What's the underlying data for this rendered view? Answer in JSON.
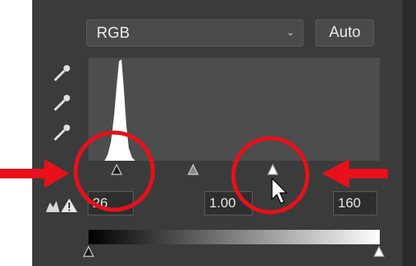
{
  "levels": {
    "channel": "RGB",
    "auto_label": "Auto",
    "input_black": "26",
    "input_gamma": "1.00",
    "input_white": "160"
  },
  "icons": [
    "black-point-eyedropper-icon",
    "gray-point-eyedropper-icon",
    "white-point-eyedropper-icon",
    "clipping-warning-icon",
    "chevron-down-icon",
    "mouse-cursor-icon"
  ],
  "colors": {
    "panel": "#3b3b3b",
    "annotation": "#e8101a"
  }
}
